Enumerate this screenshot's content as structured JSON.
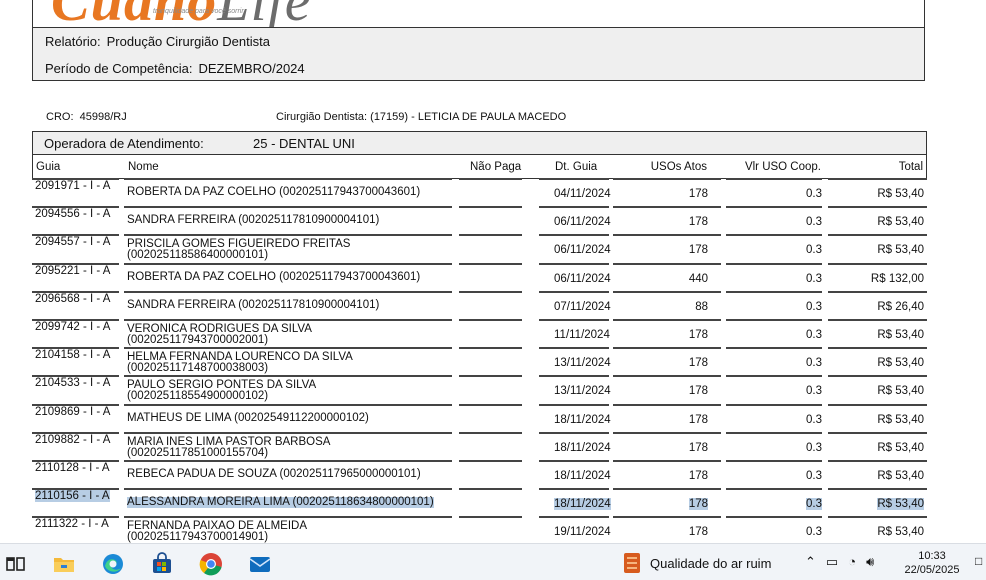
{
  "header": {
    "logo_main": "Cuano",
    "logo_life": "Life",
    "logo_tagline": "tranquilidade para você sorrir",
    "relatorio_label": "Relatório:",
    "relatorio_value": "Produção Cirurgião Dentista",
    "periodo_label": "Período de Competência:",
    "periodo_value": "DEZEMBRO/2024"
  },
  "dentist": {
    "cro_label": "CRO:",
    "cro_value": "45998/RJ",
    "dentista": "Cirurgião Dentista: (17159) - LETICIA DE PAULA MACEDO"
  },
  "operadora": {
    "label": "Operadora de Atendimento:",
    "value": "25 - DENTAL UNI"
  },
  "table": {
    "columns": [
      "Guia",
      "Nome",
      "Não Paga",
      "Dt. Guia",
      "USOs Atos",
      "Vlr USO Coop.",
      "Total"
    ],
    "rows": [
      {
        "guia": "2091971 - I - A",
        "nome1": "ROBERTA DA PAZ COELHO (002025117943700043601)",
        "nome2": "",
        "dt": "04/11/2024",
        "usos": "178",
        "vlr": "0.3",
        "total": "R$ 53,40"
      },
      {
        "guia": "2094556 - I - A",
        "nome1": "SANDRA FERREIRA (002025117810900004101)",
        "nome2": "",
        "dt": "06/11/2024",
        "usos": "178",
        "vlr": "0.3",
        "total": "R$ 53,40"
      },
      {
        "guia": "2094557 - I - A",
        "nome1": "PRISCILA GOMES FIGUEIREDO FREITAS",
        "nome2": "(002025118586400000101)",
        "dt": "06/11/2024",
        "usos": "178",
        "vlr": "0.3",
        "total": "R$ 53,40"
      },
      {
        "guia": "2095221 - I - A",
        "nome1": "ROBERTA DA PAZ COELHO (002025117943700043601)",
        "nome2": "",
        "dt": "06/11/2024",
        "usos": "440",
        "vlr": "0.3",
        "total": "R$ 132,00"
      },
      {
        "guia": "2096568 - I - A",
        "nome1": "SANDRA FERREIRA (002025117810900004101)",
        "nome2": "",
        "dt": "07/11/2024",
        "usos": "88",
        "vlr": "0.3",
        "total": "R$ 26,40"
      },
      {
        "guia": "2099742 - I - A",
        "nome1": "VERONICA RODRIGUES DA SILVA",
        "nome2": "(002025117943700002001)",
        "dt": "11/11/2024",
        "usos": "178",
        "vlr": "0.3",
        "total": "R$ 53,40"
      },
      {
        "guia": "2104158 - I - A",
        "nome1": "HELMA FERNANDA LOURENCO DA SILVA",
        "nome2": "(002025117148700038003)",
        "dt": "13/11/2024",
        "usos": "178",
        "vlr": "0.3",
        "total": "R$ 53,40"
      },
      {
        "guia": "2104533 - I - A",
        "nome1": "PAULO SERGIO PONTES DA SILVA",
        "nome2": "(002025118554900000102)",
        "dt": "13/11/2024",
        "usos": "178",
        "vlr": "0.3",
        "total": "R$ 53,40"
      },
      {
        "guia": "2109869 - I - A",
        "nome1": "MATHEUS DE LIMA (00202549112200000102)",
        "nome2": "",
        "dt": "18/11/2024",
        "usos": "178",
        "vlr": "0.3",
        "total": "R$ 53,40"
      },
      {
        "guia": "2109882 - I - A",
        "nome1": "MARIA INES LIMA PASTOR BARBOSA",
        "nome2": "(002025117851000155704)",
        "dt": "18/11/2024",
        "usos": "178",
        "vlr": "0.3",
        "total": "R$ 53,40"
      },
      {
        "guia": "2110128 - I - A",
        "nome1": "REBECA PADUA DE SOUZA (002025117965000000101)",
        "nome2": "",
        "dt": "18/11/2024",
        "usos": "178",
        "vlr": "0.3",
        "total": "R$ 53,40"
      },
      {
        "guia": "2110156 - I - A",
        "nome1": "ALESSANDRA MOREIRA LIMA (002025118634800000101)",
        "nome2": "",
        "dt": "18/11/2024",
        "usos": "178",
        "vlr": "0.3",
        "total": "R$ 53,40",
        "highlighted": true
      },
      {
        "guia": "2111322 - I - A",
        "nome1": "FERNANDA PAIXAO DE ALMEIDA",
        "nome2": "(002025117943700014901)",
        "dt": "19/11/2024",
        "usos": "178",
        "vlr": "0.3",
        "total": "R$ 53,40"
      }
    ]
  },
  "taskbar": {
    "weather_text": "Qualidade do ar ruim",
    "time": "10:33",
    "date": "22/05/2025",
    "icons": [
      "task-view-icon",
      "file-explorer-icon",
      "edge-icon",
      "store-icon",
      "chrome-icon",
      "mail-icon"
    ],
    "selection_color": "#b7cde4"
  }
}
